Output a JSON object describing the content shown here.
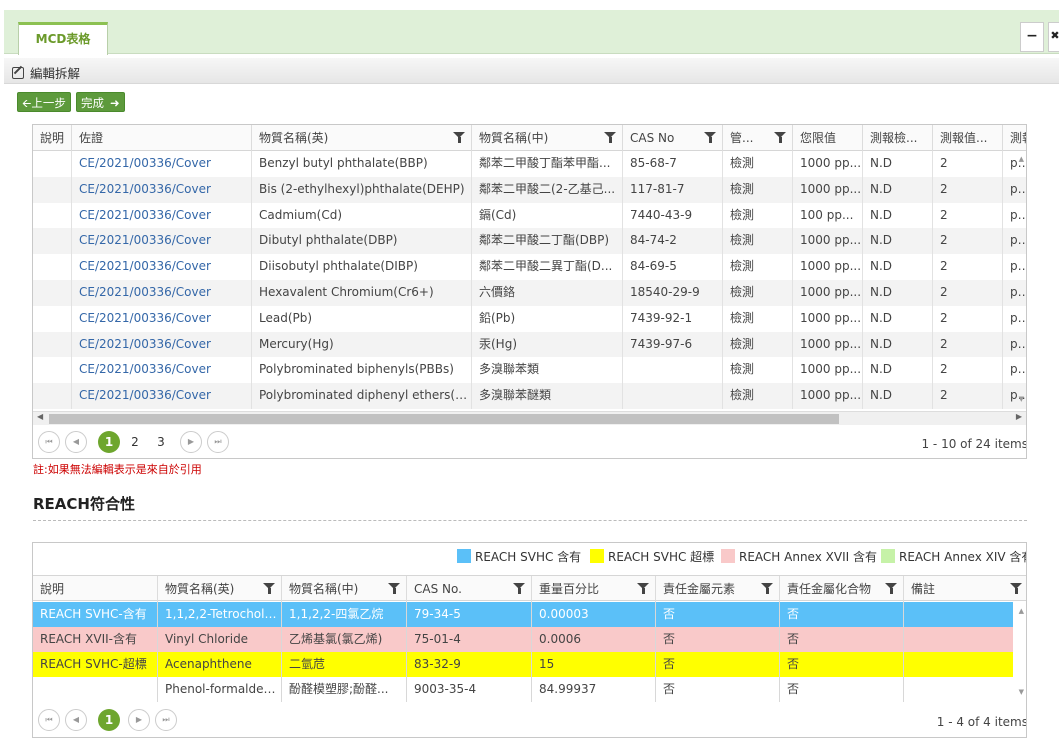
{
  "tab": {
    "label": "MCD表格"
  },
  "window": {
    "minimize": "−",
    "close": "✖"
  },
  "toolbar": {
    "label": "編輯拆解"
  },
  "nav": {
    "back": "上一步",
    "done": "完成"
  },
  "mcd_grid": {
    "headers": [
      "說明",
      "佐證",
      "物質名稱(英)",
      "物質名稱(中)",
      "CAS No",
      "管...",
      "您限值",
      "測報檢...",
      "測報值...",
      "測報"
    ],
    "rows": [
      [
        "",
        "CE/2021/00336/Cover",
        "Benzyl butyl phthalate(BBP)",
        "鄰苯二甲酸丁酯苯甲酯...",
        "85-68-7",
        "檢測",
        "1000 pp...",
        "N.D",
        "2",
        "ppr"
      ],
      [
        "",
        "CE/2021/00336/Cover",
        "Bis (2-ethylhexyl)phthalate(DEHP)",
        "鄰苯二甲酸二(2-乙基己...",
        "117-81-7",
        "檢測",
        "1000 pp...",
        "N.D",
        "2",
        "ppr"
      ],
      [
        "",
        "CE/2021/00336/Cover",
        "Cadmium(Cd)",
        "鎘(Cd)",
        "7440-43-9",
        "檢測",
        "100 pp...",
        "N.D",
        "2",
        "ppr"
      ],
      [
        "",
        "CE/2021/00336/Cover",
        "Dibutyl phthalate(DBP)",
        "鄰苯二甲酸二丁酯(DBP)",
        "84-74-2",
        "檢測",
        "1000 pp...",
        "N.D",
        "2",
        "ppr"
      ],
      [
        "",
        "CE/2021/00336/Cover",
        "Diisobutyl phthalate(DIBP)",
        "鄰苯二甲酸二異丁酯(D...",
        "84-69-5",
        "檢測",
        "1000 pp...",
        "N.D",
        "2",
        "ppr"
      ],
      [
        "",
        "CE/2021/00336/Cover",
        "Hexavalent Chromium(Cr6+)",
        "六價鉻",
        "18540-29-9",
        "檢測",
        "1000 pp...",
        "N.D",
        "2",
        "ppr"
      ],
      [
        "",
        "CE/2021/00336/Cover",
        "Lead(Pb)",
        "鉛(Pb)",
        "7439-92-1",
        "檢測",
        "1000 pp...",
        "N.D",
        "2",
        "ppr"
      ],
      [
        "",
        "CE/2021/00336/Cover",
        "Mercury(Hg)",
        "汞(Hg)",
        "7439-97-6",
        "檢測",
        "1000 pp...",
        "N.D",
        "2",
        "ppr"
      ],
      [
        "",
        "CE/2021/00336/Cover",
        "Polybrominated biphenyls(PBBs)",
        "多溴聯苯類",
        "",
        "檢測",
        "1000 pp...",
        "N.D",
        "2",
        "ppr"
      ],
      [
        "",
        "CE/2021/00336/Cover",
        "Polybrominated diphenyl ethers(PB...",
        "多溴聯苯醚類",
        "",
        "檢測",
        "1000 pp...",
        "N.D",
        "2",
        "ppr"
      ]
    ],
    "pages": [
      "1",
      "2",
      "3"
    ],
    "current_page": "1",
    "info": "1 - 10 of 24 items"
  },
  "note": "註:如果無法編輯表示是來自於引用",
  "reach": {
    "title": "REACH符合性",
    "legend": [
      {
        "label": "REACH SVHC 含有",
        "color": "#5bc0f8"
      },
      {
        "label": "REACH SVHC 超標",
        "color": "#ffff00"
      },
      {
        "label": "REACH Annex XVII 含有",
        "color": "#f9c9c9"
      },
      {
        "label": "REACH Annex XIV 含有",
        "color": "#c6f2a8"
      }
    ],
    "headers": [
      "說明",
      "物質名稱(英)",
      "物質名稱(中)",
      "CAS No.",
      "重量百分比",
      "責任金屬元素",
      "責任金屬化合物",
      "備註"
    ],
    "rows": [
      {
        "color": "#5bc0f8",
        "text": "#ffffff",
        "cells": [
          "REACH SVHC-含有",
          "1,1,2,2-Tetrocholo...",
          "1,1,2,2-四氯乙烷",
          "79-34-5",
          "0.00003",
          "否",
          "否",
          ""
        ]
      },
      {
        "color": "#f9c9c9",
        "text": "#444444",
        "cells": [
          "REACH XVII-含有",
          "Vinyl Chloride",
          "乙烯基氯(氯乙烯)",
          "75-01-4",
          "0.0006",
          "否",
          "否",
          ""
        ]
      },
      {
        "color": "#ffff00",
        "text": "#444444",
        "cells": [
          "REACH SVHC-超標",
          "Acenaphthene",
          "二氫苊",
          "83-32-9",
          "15",
          "否",
          "否",
          ""
        ]
      },
      {
        "color": "#ffffff",
        "text": "#444444",
        "cells": [
          "",
          "Phenol-formaldeh...",
          "酚醛模塑膠;酚醛...",
          "9003-35-4",
          "84.99937",
          "否",
          "否",
          ""
        ]
      }
    ],
    "pages": [
      "1"
    ],
    "current_page": "1",
    "info": "1 - 4 of 4 items"
  }
}
